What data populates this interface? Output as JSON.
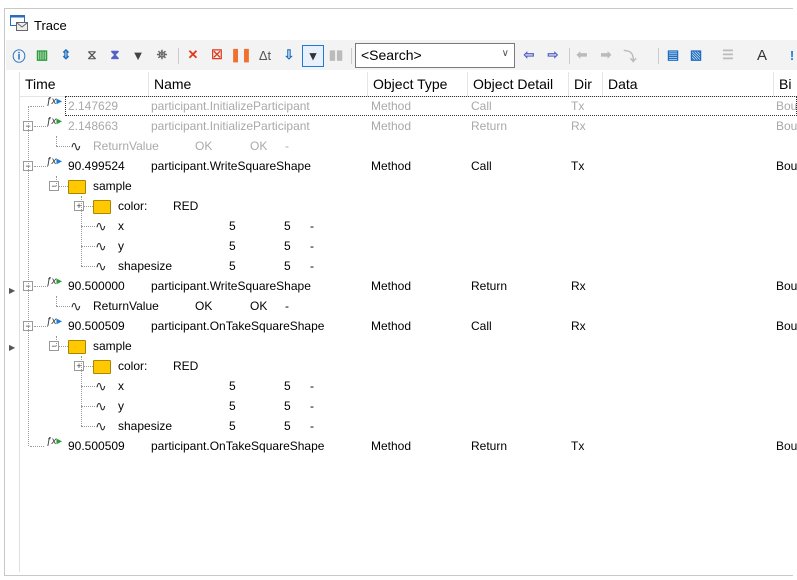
{
  "window": {
    "title": "Trace"
  },
  "toolbar": {
    "search_placeholder": "<Search>"
  },
  "columns": [
    "Time",
    "Name",
    "Object Type",
    "Object Detail",
    "Dir",
    "Data",
    "Bi"
  ],
  "rows": [
    {
      "time": "2.147629",
      "name": "participant.InitializeParticipant",
      "type": "Method",
      "detail": "Call",
      "dir": "Tx",
      "extra": "Bou"
    },
    {
      "time": "2.148663",
      "name": "participant.InitializeParticipant",
      "type": "Method",
      "detail": "Return",
      "dir": "Rx",
      "extra": "Bou"
    },
    {
      "label": "ReturnValue",
      "v1": "OK",
      "v2": "OK",
      "v3": "-"
    },
    {
      "time": "90.499524",
      "name": "participant.WriteSquareShape",
      "type": "Method",
      "detail": "Call",
      "dir": "Tx",
      "extra": "Bou"
    },
    {
      "label": "sample"
    },
    {
      "label": "color:",
      "v1": "RED"
    },
    {
      "label": "x",
      "v1": "5",
      "v2": "5",
      "v3": "-"
    },
    {
      "label": "y",
      "v1": "5",
      "v2": "5",
      "v3": "-"
    },
    {
      "label": "shapesize",
      "v1": "5",
      "v2": "5",
      "v3": "-"
    },
    {
      "time": "90.500000",
      "name": "participant.WriteSquareShape",
      "type": "Method",
      "detail": "Return",
      "dir": "Rx",
      "extra": "Bou"
    },
    {
      "label": "ReturnValue",
      "v1": "OK",
      "v2": "OK",
      "v3": "-"
    },
    {
      "time": "90.500509",
      "name": "participant.OnTakeSquareShape",
      "type": "Method",
      "detail": "Call",
      "dir": "Rx",
      "extra": "Bou"
    },
    {
      "label": "sample"
    },
    {
      "label": "color:",
      "v1": "RED"
    },
    {
      "label": "x",
      "v1": "5",
      "v2": "5",
      "v3": "-"
    },
    {
      "label": "y",
      "v1": "5",
      "v2": "5",
      "v3": "-"
    },
    {
      "label": "shapesize",
      "v1": "5",
      "v2": "5",
      "v3": "-"
    },
    {
      "time": "90.500509",
      "name": "participant.OnTakeSquareShape",
      "type": "Method",
      "detail": "Return",
      "dir": "Tx",
      "extra": "Bou"
    }
  ]
}
